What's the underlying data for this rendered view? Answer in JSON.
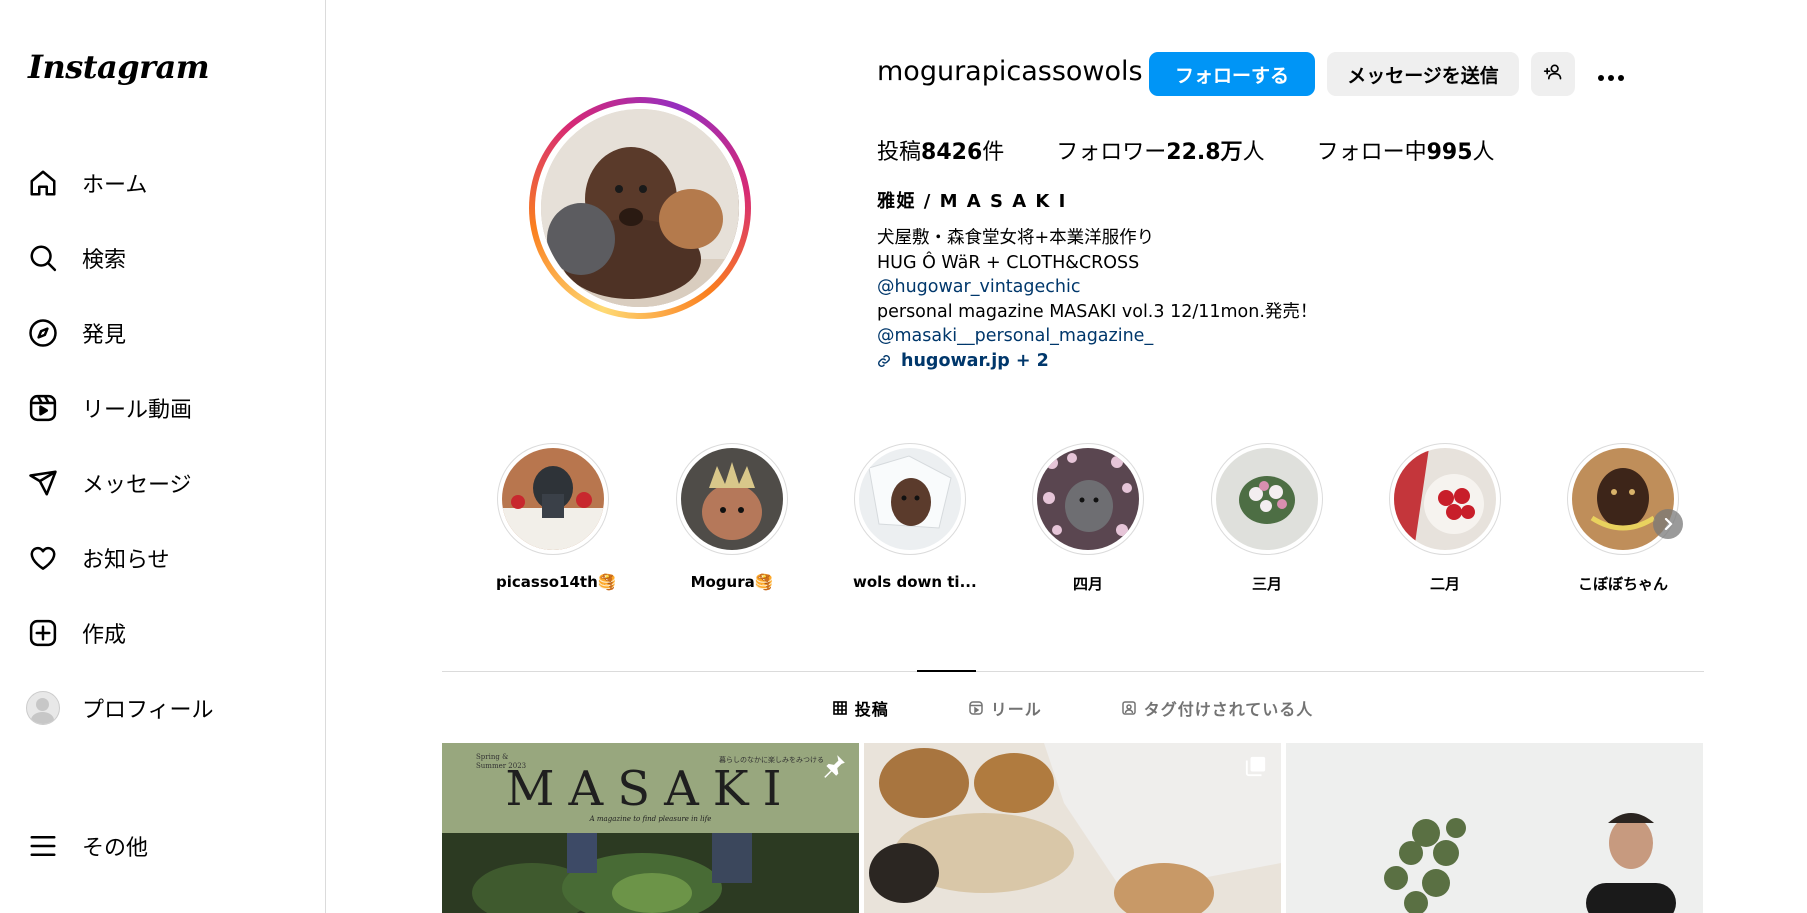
{
  "sidebar": {
    "logo": "Instagram",
    "items": [
      {
        "label": "ホーム",
        "icon": "home-icon"
      },
      {
        "label": "検索",
        "icon": "search-icon"
      },
      {
        "label": "発見",
        "icon": "compass-icon"
      },
      {
        "label": "リール動画",
        "icon": "reels-icon"
      },
      {
        "label": "メッセージ",
        "icon": "send-icon"
      },
      {
        "label": "お知らせ",
        "icon": "heart-icon"
      },
      {
        "label": "作成",
        "icon": "plus-square-icon"
      },
      {
        "label": "プロフィール",
        "icon": "avatar"
      }
    ],
    "more_label": "その他"
  },
  "profile": {
    "username": "mogurapicassowols",
    "follow_label": "フォローする",
    "message_label": "メッセージを送信",
    "stats": {
      "posts_prefix": "投稿",
      "posts_value": "8426",
      "posts_suffix": "件",
      "followers_prefix": "フォロワー",
      "followers_value": "22.8万",
      "followers_suffix": "人",
      "following_prefix": "フォロー中",
      "following_value": "995",
      "following_suffix": "人"
    },
    "fullname": "雅姫 / M A S A K I",
    "bio": {
      "line1": "犬屋敷・森食堂女将+本業洋服作り",
      "line2": "HUG Ô WäR + CLOTH&CROSS",
      "mention1": "@hugowar_vintagechic",
      "line3": "personal magazine MASAKI vol.3 12/11mon.発売！",
      "mention2": "@masaki__personal_magazine_",
      "website": "hugowar.jp + 2"
    }
  },
  "highlights": [
    {
      "name": "picasso14th🥞"
    },
    {
      "name": "Mogura🥞"
    },
    {
      "name": "wols down ti..."
    },
    {
      "name": "四月"
    },
    {
      "name": "三月"
    },
    {
      "name": "二月"
    },
    {
      "name": "こぼぼちゃん"
    }
  ],
  "tabs": {
    "posts": "投稿",
    "reels": "リール",
    "tagged": "タグ付けされている人"
  },
  "posts": {
    "post1_header_left": "Spring & Summer 2023",
    "post1_header_right": "暮らしのなかに楽しみをみつける",
    "post1_title": "MASAKI",
    "post1_subtitle": "A magazine to find pleasure in life"
  }
}
